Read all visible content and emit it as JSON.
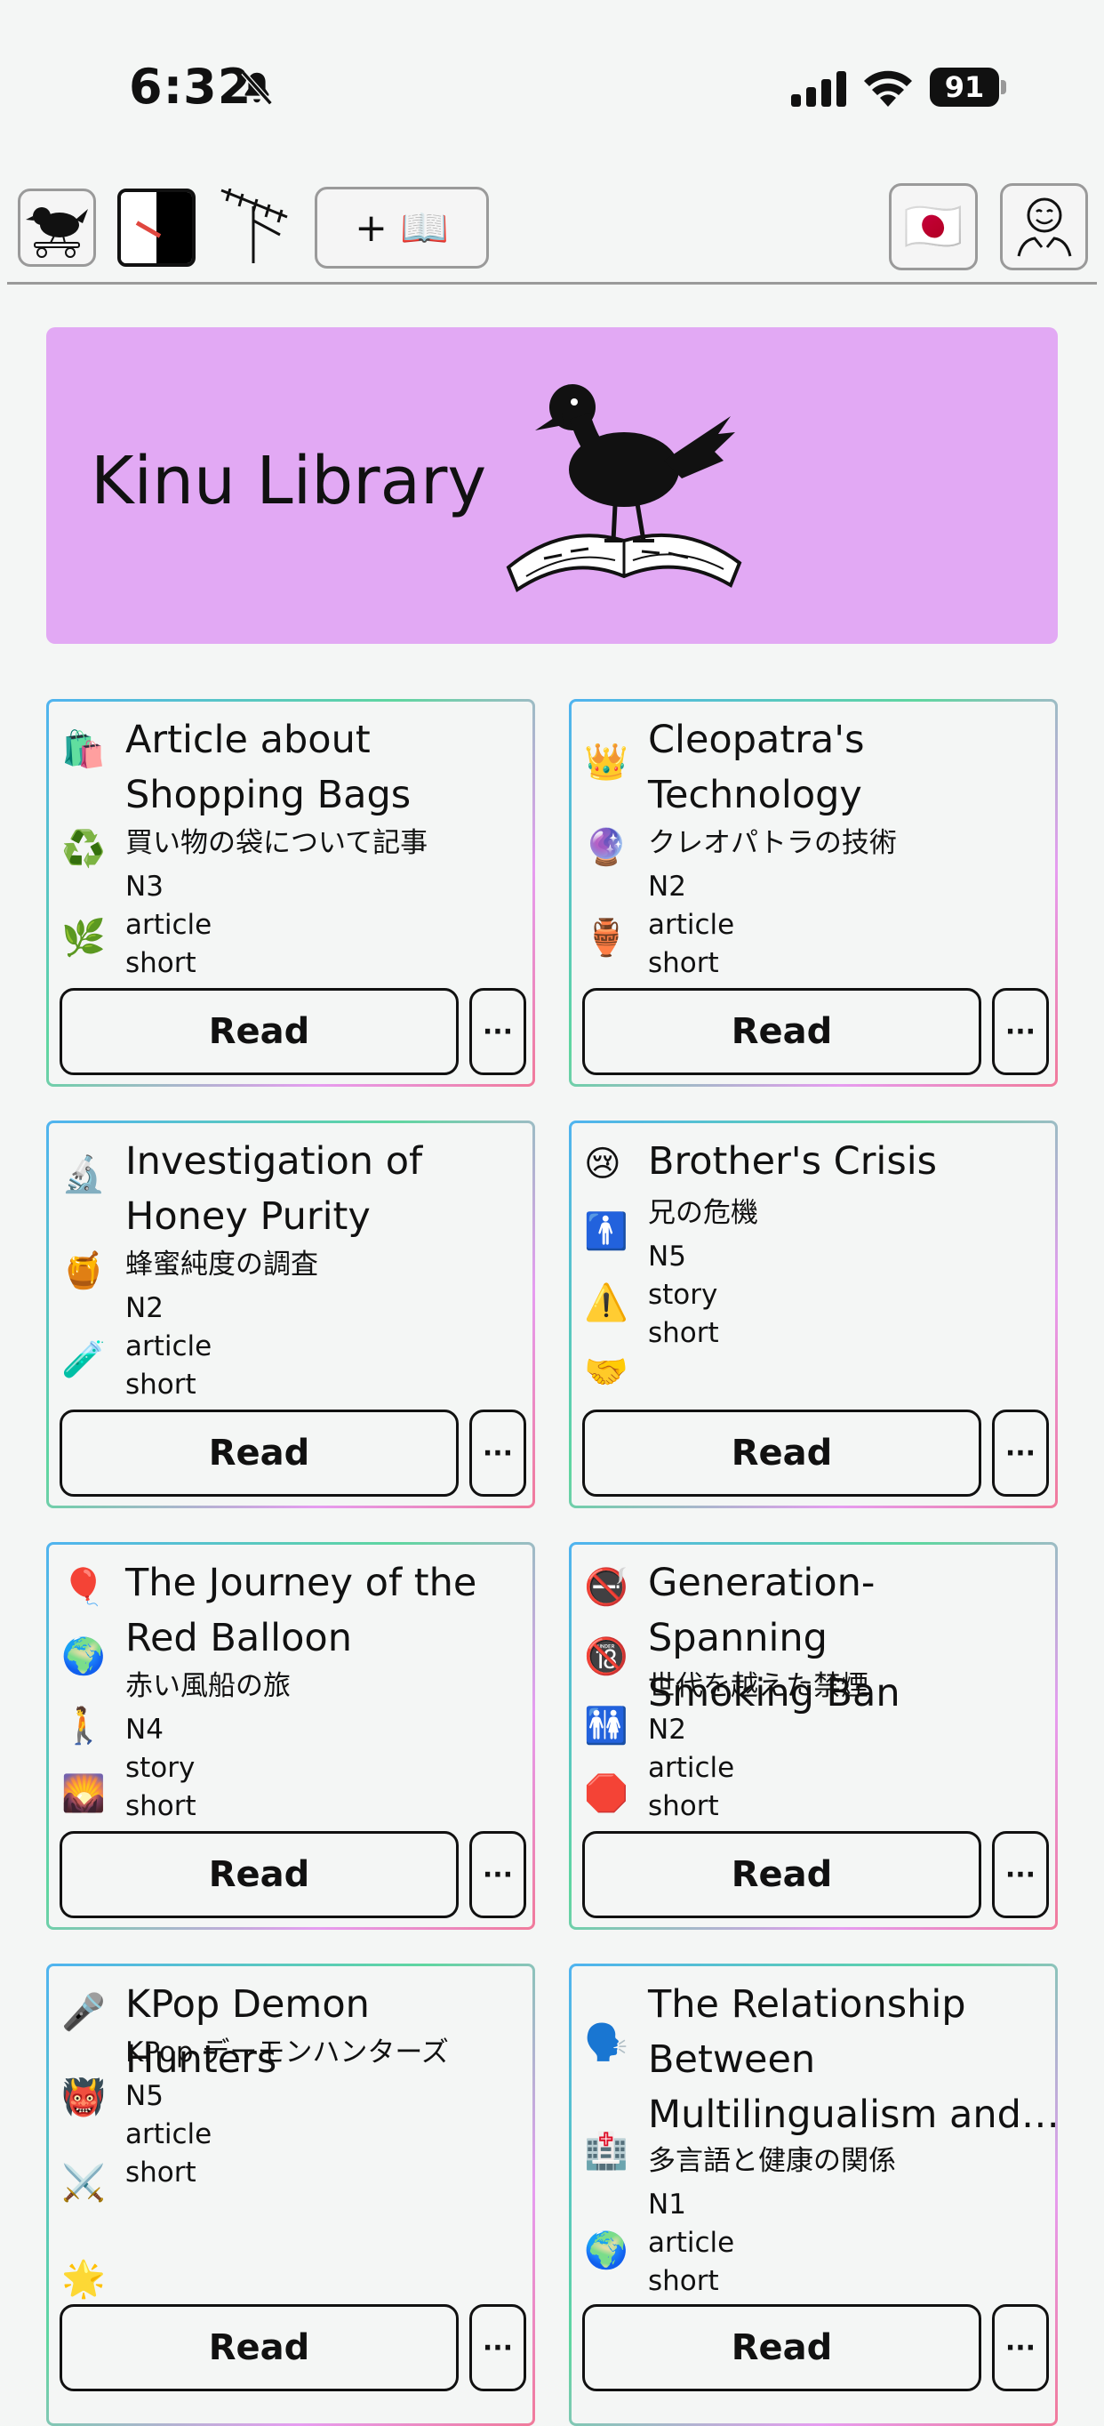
{
  "status_bar": {
    "time": "6:32",
    "battery": "91"
  },
  "toolbar": {
    "add_label": "+ 📖",
    "language_flag": "🇯🇵"
  },
  "banner": {
    "title": "Kinu Library"
  },
  "cards": [
    {
      "title_line1": "Article about",
      "title_line2": "Shopping Bags",
      "subtitle": "買い物の袋について記事",
      "level": "N3",
      "type": "article",
      "length": "short",
      "icons": [
        "🛍️",
        "♻️",
        "🌿"
      ],
      "read_label": "Read",
      "more_label": "···"
    },
    {
      "title_line1": "Cleopatra's",
      "title_line2": "Technology",
      "subtitle": "クレオパトラの技術",
      "level": "N2",
      "type": "article",
      "length": "short",
      "icons": [
        "👑",
        "🔮",
        "🏺"
      ],
      "read_label": "Read",
      "more_label": "···"
    },
    {
      "title_line1": "Investigation of",
      "title_line2": "Honey Purity",
      "subtitle": "蜂蜜純度の調査",
      "level": "N2",
      "type": "article",
      "length": "short",
      "icons": [
        "🔬",
        "🍯",
        "🧪"
      ],
      "read_label": "Read",
      "more_label": "···"
    },
    {
      "title_line1": "Brother's Crisis",
      "title_line2": "",
      "subtitle": "兄の危機",
      "level": "N5",
      "type": "story",
      "length": "short",
      "icons": [
        "😢",
        "🚹",
        "⚠️",
        "🤝"
      ],
      "read_label": "Read",
      "more_label": "···"
    },
    {
      "title_line1": "The Journey of the",
      "title_line2": "Red Balloon",
      "subtitle": "赤い風船の旅",
      "level": "N4",
      "type": "story",
      "length": "short",
      "icons": [
        "🎈",
        "🌍",
        "🚶",
        "🌄"
      ],
      "read_label": "Read",
      "more_label": "···"
    },
    {
      "title_line1": "Generation-Spanning",
      "title_line2": "Smoking Ban",
      "subtitle": "世代を越えた禁煙",
      "level": "N2",
      "type": "article",
      "length": "short",
      "icons": [
        "🚭",
        "🔞",
        "🚻",
        "🛑"
      ],
      "read_label": "Read",
      "more_label": "···"
    },
    {
      "title_line1": "KPop Demon Hunters",
      "title_line2": "",
      "subtitle": "KPop デーモンハンターズ",
      "level": "N5",
      "type": "article",
      "length": "short",
      "icons": [
        "🎤",
        "👹",
        "⚔️",
        "🌟"
      ],
      "read_label": "Read",
      "more_label": "···"
    },
    {
      "title_line1": "The Relationship",
      "title_line2": "Between",
      "title_line3": "Multilingualism and…",
      "subtitle": "多言語と健康の関係",
      "level": "N1",
      "type": "article",
      "length": "short",
      "icons": [
        "🗣️",
        "🏥",
        "🌍"
      ],
      "read_label": "Read",
      "more_label": "···"
    }
  ]
}
